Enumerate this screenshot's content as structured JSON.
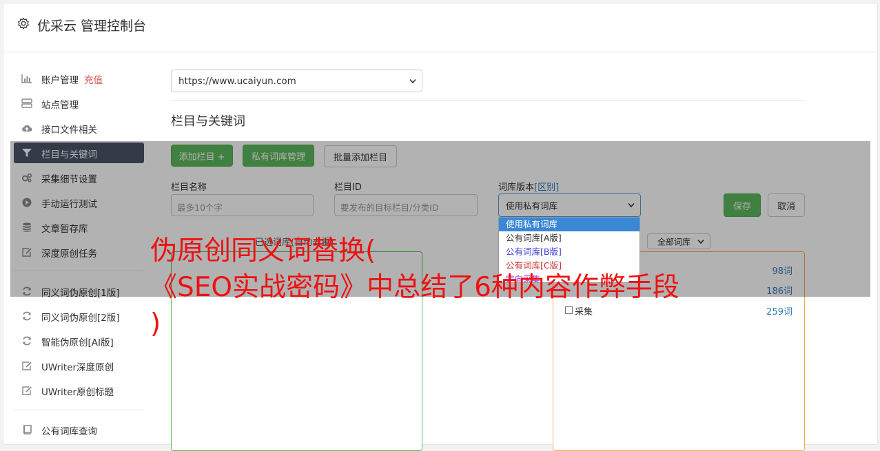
{
  "header": {
    "title": "优采云 管理控制台",
    "icon": "gear-icon"
  },
  "sidebar": {
    "items": [
      {
        "label": "账户管理",
        "extra": "充值",
        "icon": "bar-chart-icon"
      },
      {
        "label": "站点管理",
        "icon": "server-icon"
      },
      {
        "label": "接口文件相关",
        "icon": "cloud-upload-icon"
      },
      {
        "label": "栏目与关键词",
        "icon": "filter-icon",
        "active": true
      },
      {
        "label": "采集细节设置",
        "icon": "cogs-icon"
      },
      {
        "label": "手动运行测试",
        "icon": "play-circle-icon"
      },
      {
        "label": "文章暂存库",
        "icon": "database-icon"
      },
      {
        "label": "深度原创任务",
        "icon": "edit-icon"
      },
      {
        "label": "同义词伪原创[1版]",
        "icon": "refresh-icon"
      },
      {
        "label": "同义词伪原创[2版]",
        "icon": "refresh-icon"
      },
      {
        "label": "智能伪原创[AI版]",
        "icon": "refresh-icon"
      },
      {
        "label": "UWriter深度原创",
        "icon": "edit-icon"
      },
      {
        "label": "UWriter原创标题",
        "icon": "edit-icon"
      },
      {
        "label": "公有词库查询",
        "icon": "book-icon"
      }
    ]
  },
  "main": {
    "site_select": "https://www.ucaiyun.com",
    "section_title": "栏目与关键词",
    "buttons": {
      "add": "添加栏目 +",
      "private": "私有词库管理",
      "batch": "批量添加栏目",
      "save": "保存",
      "cancel": "取消"
    },
    "fields": {
      "name_label": "栏目名称",
      "name_placeholder": "最多10个字",
      "id_label": "栏目ID",
      "id_placeholder": "要发布的目标栏目/分类ID",
      "version_label": "词库版本",
      "version_link": "[区别]",
      "version_value": "使用私有词库"
    },
    "dropdown_options": [
      "使用私有词库",
      "公有词库[A版]",
      "公有词库[B版]",
      "公有词库[C版]",
      "定向采集"
    ],
    "selected_caption": "已选词库(自动去重)",
    "filter_select": "全部词库",
    "libraries": [
      {
        "name": "",
        "count": "98词"
      },
      {
        "name": "",
        "count": "186词"
      },
      {
        "name": "采集",
        "count": "259词"
      }
    ]
  },
  "watermark": "伪原创同义词替换(\n《SEO实战密码》中总结了6种内容作弊手段\n)",
  "colors": {
    "accent_green": "#5cb85c",
    "active_sidebar": "#4a5568",
    "recharge_red": "#d9534f",
    "watermark_red": "#ee1111",
    "dropdown_selected": "#3a87d6"
  }
}
